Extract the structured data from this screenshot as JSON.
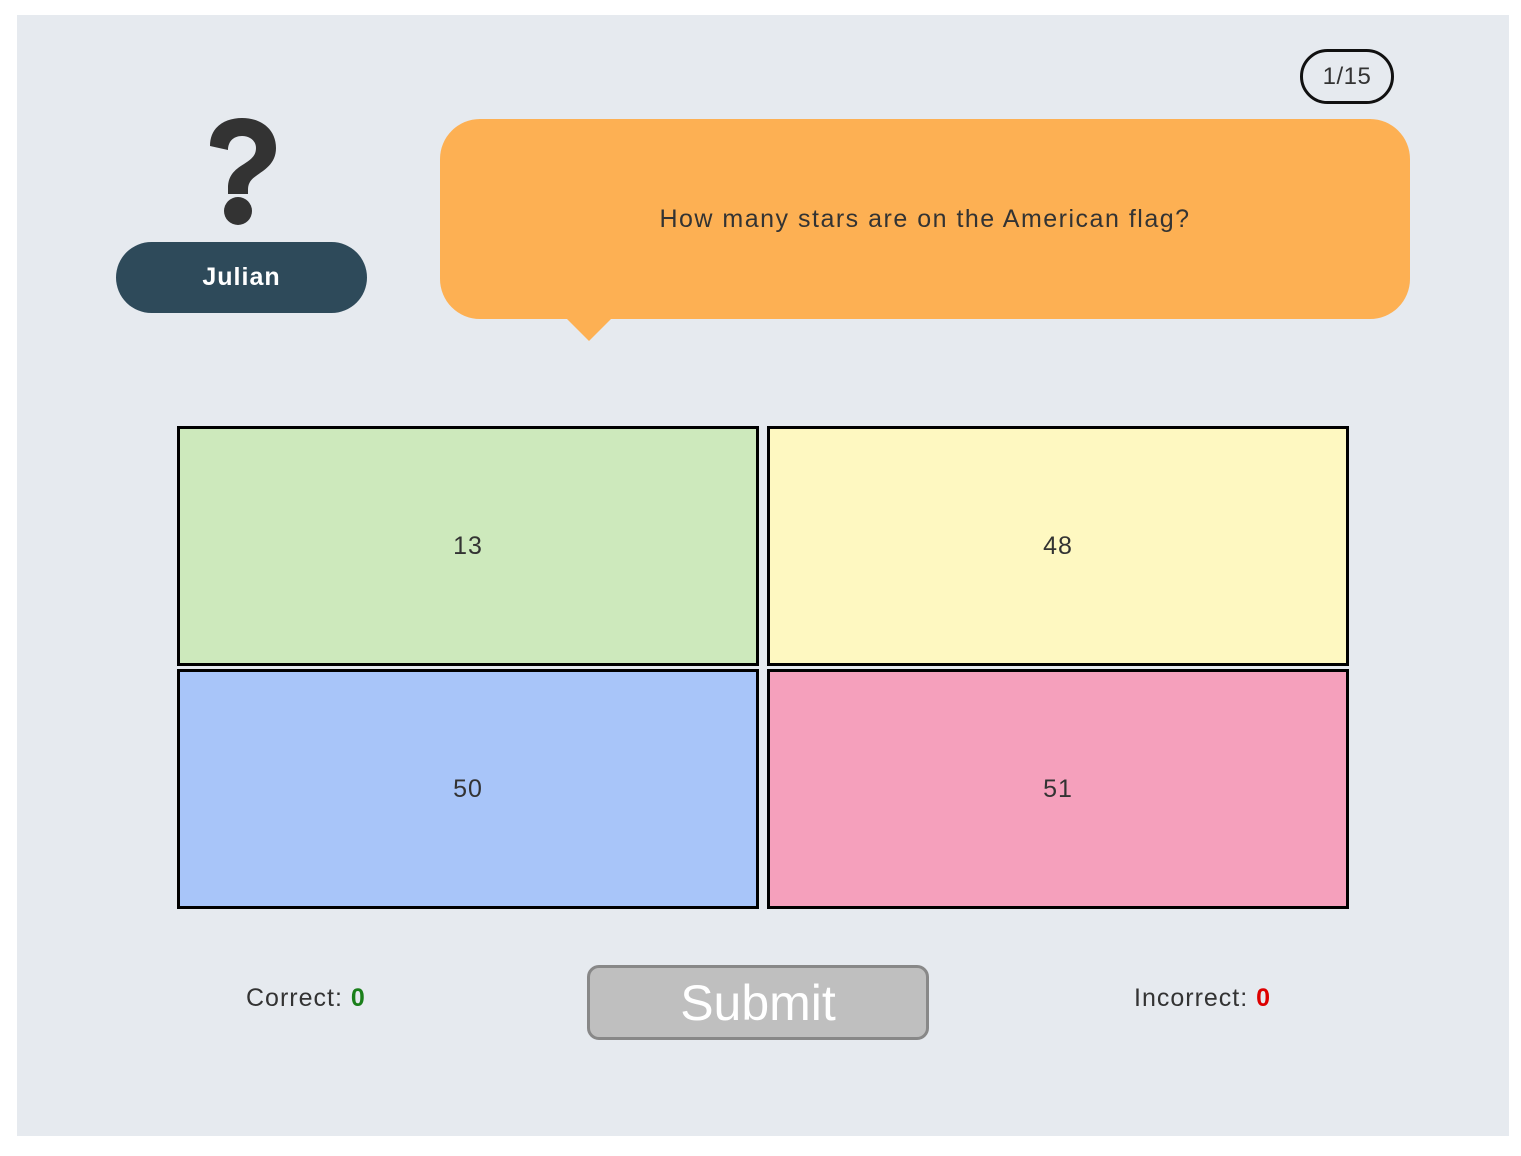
{
  "progress": "1/15",
  "player": {
    "name": "Julian",
    "icon": "question-mark-icon"
  },
  "question": {
    "text": "How many stars are on the American flag?",
    "bubble_color": "#fdb053"
  },
  "answers": [
    {
      "label": "13",
      "color": "#cde9bc"
    },
    {
      "label": "48",
      "color": "#fef8c1"
    },
    {
      "label": "50",
      "color": "#a8c5f9"
    },
    {
      "label": "51",
      "color": "#f5a0bc"
    }
  ],
  "score": {
    "correct_label": "Correct:",
    "correct_value": "0",
    "correct_color": "#1a7f1a",
    "incorrect_label": "Incorrect:",
    "incorrect_value": "0",
    "incorrect_color": "#dd0000"
  },
  "submit_label": "Submit"
}
